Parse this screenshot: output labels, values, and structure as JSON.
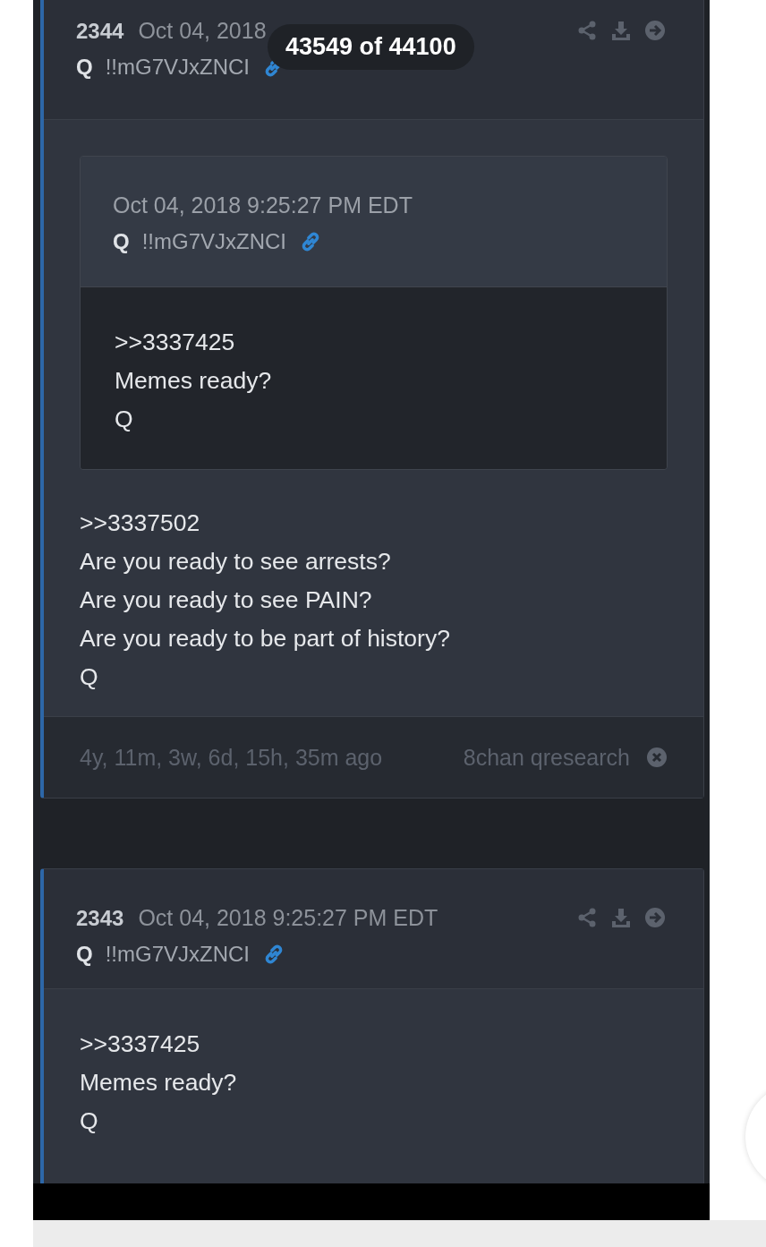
{
  "counter": "43549 of 44100",
  "posts": [
    {
      "number": "2344",
      "date": "Oct 04, 2018",
      "author": "Q",
      "tripcode": "!!mG7VJxZNCI",
      "quote": {
        "date": "Oct 04, 2018 9:25:27 PM EDT",
        "author": "Q",
        "tripcode": "!!mG7VJxZNCI",
        "lines": [
          ">>3337425",
          "Memes ready?",
          "Q"
        ]
      },
      "lines": [
        ">>3337502",
        "Are you ready to see arrests?",
        "Are you ready to see PAIN?",
        "Are you ready to be part of history?",
        "Q"
      ],
      "footer": {
        "ago": "4y, 11m, 3w, 6d, 15h, 35m ago",
        "source": "8chan qresearch"
      }
    },
    {
      "number": "2343",
      "date": "Oct 04, 2018 9:25:27 PM EDT",
      "author": "Q",
      "tripcode": "!!mG7VJxZNCI",
      "lines": [
        ">>3337425",
        "Memes ready?",
        "Q"
      ]
    }
  ]
}
